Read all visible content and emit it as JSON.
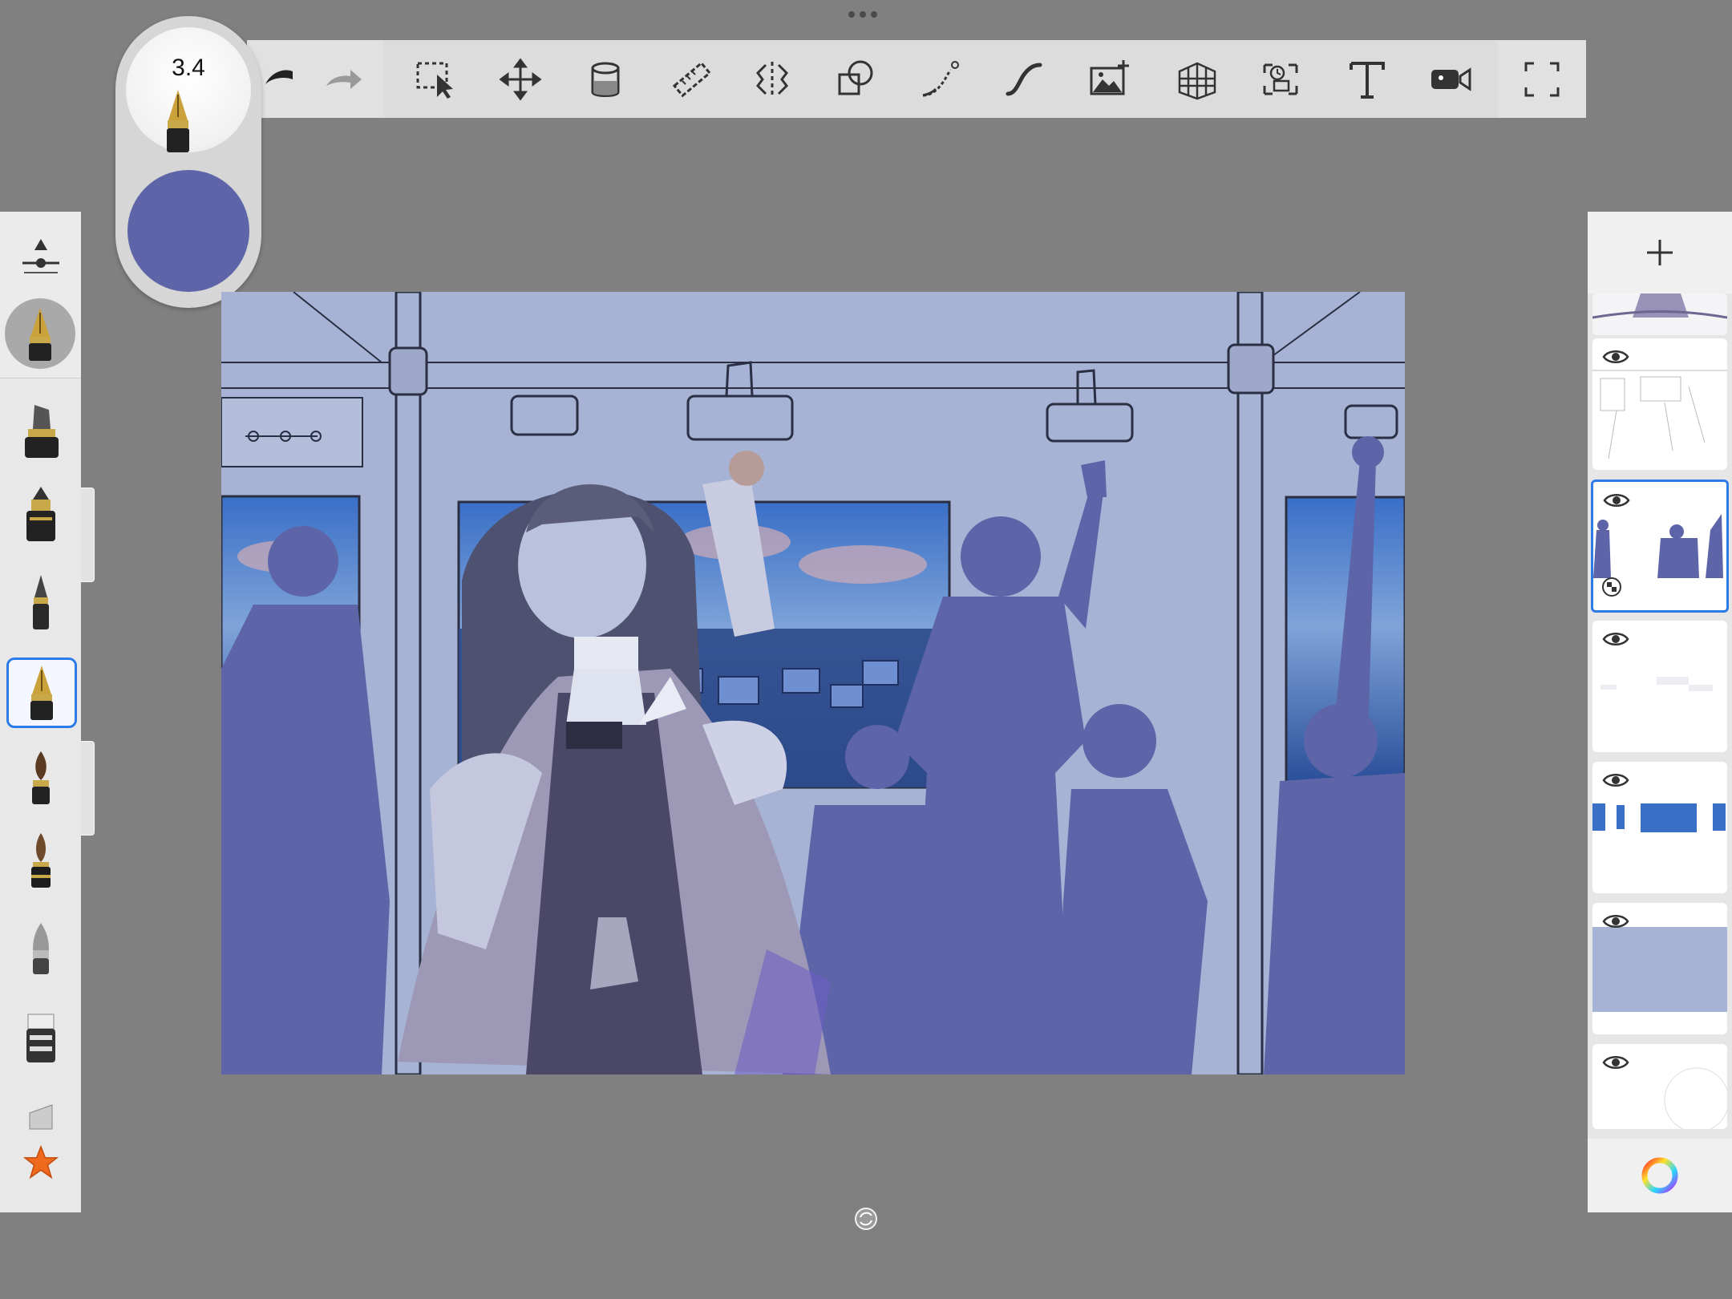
{
  "brush_puck": {
    "size_value": "3.4",
    "current_color": "#5d64a8",
    "brush_icon": "fountain-pen-icon"
  },
  "toolbar": {
    "tools": [
      "undo-icon",
      "redo-icon",
      "selection-icon",
      "transform-icon",
      "fill-bucket-icon",
      "ruler-icon",
      "symmetry-icon",
      "shape-icon",
      "curve-icon",
      "stroke-icon",
      "import-image-icon",
      "perspective-icon",
      "time-lapse-icon",
      "text-icon",
      "video-icon",
      "fullscreen-icon"
    ]
  },
  "brush_palette": {
    "brushes": [
      "marker-pen-icon",
      "ink-pen-icon",
      "pencil-icon",
      "fountain-pen-icon",
      "paint-brush-icon",
      "round-brush-icon",
      "airbrush-icon",
      "eraser-icon",
      "chisel-marker-icon"
    ],
    "selected_index": 3,
    "favorites_icon": "star-icon"
  },
  "layers": {
    "items": [
      {
        "name": "layer-portrait",
        "visible": true
      },
      {
        "name": "layer-sketch-lines",
        "visible": true
      },
      {
        "name": "layer-silhouettes",
        "visible": true,
        "selected": true
      },
      {
        "name": "layer-white-details",
        "visible": true
      },
      {
        "name": "layer-window-scenery",
        "visible": true
      },
      {
        "name": "layer-background-fill",
        "visible": true
      },
      {
        "name": "layer-paper",
        "visible": true
      }
    ],
    "selected_index": 2,
    "background_fill_color": "#a6b3d4"
  },
  "colors": {
    "accent": "#2f7be6",
    "canvas_background": "#808080",
    "silhouette": "#5d64a8",
    "canvas_base": "#a6b3d4",
    "sky_blue": "#3f74c9"
  }
}
